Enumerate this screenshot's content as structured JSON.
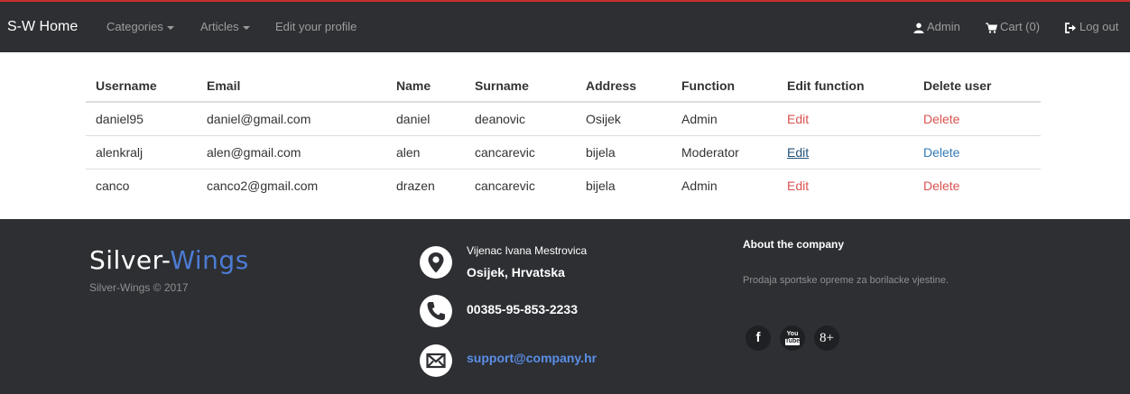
{
  "navbar": {
    "brand": "S-W Home",
    "categories": "Categories",
    "articles": "Articles",
    "edit_profile": "Edit your profile",
    "admin": "Admin",
    "cart": "Cart (0)",
    "logout": "Log out"
  },
  "table": {
    "headers": [
      "Username",
      "Email",
      "Name",
      "Surname",
      "Address",
      "Function",
      "Edit function",
      "Delete user"
    ],
    "rows": [
      {
        "username": "daniel95",
        "email": "daniel@gmail.com",
        "name": "daniel",
        "surname": "deanovic",
        "address": "Osijek",
        "function": "Admin",
        "edit": "Edit",
        "delete": "Delete"
      },
      {
        "username": "alenkralj",
        "email": "alen@gmail.com",
        "name": "alen",
        "surname": "cancarevic",
        "address": "bijela",
        "function": "Moderator",
        "edit": "Edit",
        "delete": "Delete"
      },
      {
        "username": "canco",
        "email": "canco2@gmail.com",
        "name": "drazen",
        "surname": "cancarevic",
        "address": "bijela",
        "function": "Admin",
        "edit": "Edit",
        "delete": "Delete"
      }
    ]
  },
  "footer": {
    "logo_part1": "Silver-",
    "logo_part2": "Wings",
    "copyright": "Silver-Wings © 2017",
    "address_line1": "Vijenac Ivana Mestrovica",
    "address_line2": "Osijek, Hrvatska",
    "phone": "00385-95-853-2233",
    "email": "support@company.hr",
    "about_title": "About the company",
    "about_text": "Prodaja sportske opreme za borilacke vjestine.",
    "social": {
      "facebook": "f",
      "youtube_top": "You",
      "youtube_bottom": "Tube",
      "googleplus": "8+"
    }
  },
  "colors": {
    "navbar_bg": "#2d2f33",
    "accent_red": "#d9534f",
    "accent_blue": "#337ab7",
    "logo_blue": "#4d7cd4"
  }
}
